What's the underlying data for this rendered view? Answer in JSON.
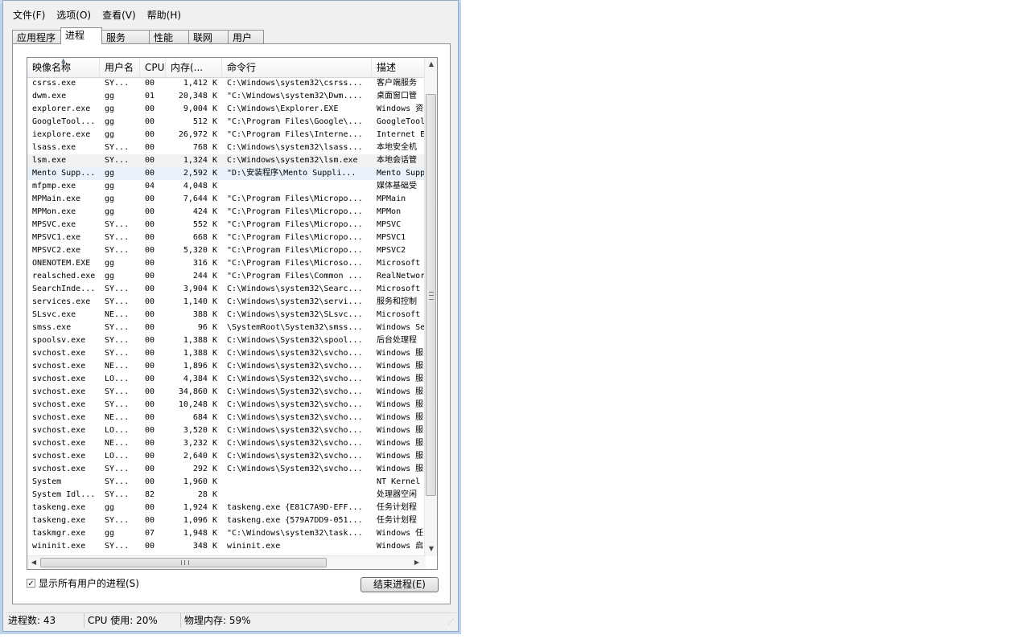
{
  "menu": [
    "文件(F)",
    "选项(O)",
    "查看(V)",
    "帮助(H)"
  ],
  "tabs": [
    "应用程序",
    "进程",
    "服务",
    "性能",
    "联网",
    "用户"
  ],
  "active_tab": "进程",
  "columns": [
    "映像名称",
    "用户名",
    "CPU",
    "内存(...",
    "命令行",
    "描述"
  ],
  "processes": [
    {
      "name": "csrss.exe",
      "user": "SY...",
      "cpu": "00",
      "mem": "1,412 K",
      "cmd": "C:\\Windows\\system32\\csrss...",
      "desc": "客户端服务"
    },
    {
      "name": "dwm.exe",
      "user": "gg",
      "cpu": "01",
      "mem": "20,348 K",
      "cmd": "\"C:\\Windows\\system32\\Dwm....",
      "desc": "桌面窗口管"
    },
    {
      "name": "explorer.exe",
      "user": "gg",
      "cpu": "00",
      "mem": "9,004 K",
      "cmd": "C:\\Windows\\Explorer.EXE",
      "desc": "Windows 资"
    },
    {
      "name": "GoogleTool...",
      "user": "gg",
      "cpu": "00",
      "mem": "512 K",
      "cmd": "\"C:\\Program Files\\Google\\...",
      "desc": "GoogleTool"
    },
    {
      "name": "iexplore.exe",
      "user": "gg",
      "cpu": "00",
      "mem": "26,972 K",
      "cmd": "\"C:\\Program Files\\Interne...",
      "desc": "Internet E"
    },
    {
      "name": "lsass.exe",
      "user": "SY...",
      "cpu": "00",
      "mem": "768 K",
      "cmd": "C:\\Windows\\system32\\lsass...",
      "desc": "本地安全机"
    },
    {
      "name": "lsm.exe",
      "user": "SY...",
      "cpu": "00",
      "mem": "1,324 K",
      "cmd": "C:\\Windows\\system32\\lsm.exe",
      "desc": "本地会话管"
    },
    {
      "name": "Mento Supp...",
      "user": "gg",
      "cpu": "00",
      "mem": "2,592 K",
      "cmd": "\"D:\\安装程序\\Mento Suppli...",
      "desc": "Mento Supp"
    },
    {
      "name": "mfpmp.exe",
      "user": "gg",
      "cpu": "04",
      "mem": "4,048 K",
      "cmd": "",
      "desc": "媒体基础受"
    },
    {
      "name": "MPMain.exe",
      "user": "gg",
      "cpu": "00",
      "mem": "7,644 K",
      "cmd": "\"C:\\Program Files\\Micropo...",
      "desc": "MPMain"
    },
    {
      "name": "MPMon.exe",
      "user": "gg",
      "cpu": "00",
      "mem": "424 K",
      "cmd": "\"C:\\Program Files\\Micropo...",
      "desc": "MPMon"
    },
    {
      "name": "MPSVC.exe",
      "user": "SY...",
      "cpu": "00",
      "mem": "552 K",
      "cmd": "\"C:\\Program Files\\Micropo...",
      "desc": "MPSVC"
    },
    {
      "name": "MPSVC1.exe",
      "user": "SY...",
      "cpu": "00",
      "mem": "668 K",
      "cmd": "\"C:\\Program Files\\Micropo...",
      "desc": "MPSVC1"
    },
    {
      "name": "MPSVC2.exe",
      "user": "SY...",
      "cpu": "00",
      "mem": "5,320 K",
      "cmd": "\"C:\\Program Files\\Micropo...",
      "desc": "MPSVC2"
    },
    {
      "name": "ONENOTEM.EXE",
      "user": "gg",
      "cpu": "00",
      "mem": "316 K",
      "cmd": "\"C:\\Program Files\\Microso...",
      "desc": "Microsoft"
    },
    {
      "name": "realsched.exe",
      "user": "gg",
      "cpu": "00",
      "mem": "244 K",
      "cmd": "\"C:\\Program Files\\Common ...",
      "desc": "RealNetwor"
    },
    {
      "name": "SearchInde...",
      "user": "SY...",
      "cpu": "00",
      "mem": "3,904 K",
      "cmd": "C:\\Windows\\system32\\Searc...",
      "desc": "Microsoft"
    },
    {
      "name": "services.exe",
      "user": "SY...",
      "cpu": "00",
      "mem": "1,140 K",
      "cmd": "C:\\Windows\\system32\\servi...",
      "desc": "服务和控制"
    },
    {
      "name": "SLsvc.exe",
      "user": "NE...",
      "cpu": "00",
      "mem": "388 K",
      "cmd": "C:\\Windows\\system32\\SLsvc...",
      "desc": "Microsoft"
    },
    {
      "name": "smss.exe",
      "user": "SY...",
      "cpu": "00",
      "mem": "96 K",
      "cmd": "\\SystemRoot\\System32\\smss...",
      "desc": "Windows Se"
    },
    {
      "name": "spoolsv.exe",
      "user": "SY...",
      "cpu": "00",
      "mem": "1,388 K",
      "cmd": "C:\\Windows\\System32\\spool...",
      "desc": "后台处理程"
    },
    {
      "name": "svchost.exe",
      "user": "SY...",
      "cpu": "00",
      "mem": "1,388 K",
      "cmd": "C:\\Windows\\system32\\svcho...",
      "desc": "Windows 服"
    },
    {
      "name": "svchost.exe",
      "user": "NE...",
      "cpu": "00",
      "mem": "1,896 K",
      "cmd": "C:\\Windows\\system32\\svcho...",
      "desc": "Windows 服"
    },
    {
      "name": "svchost.exe",
      "user": "LO...",
      "cpu": "00",
      "mem": "4,384 K",
      "cmd": "C:\\Windows\\System32\\svcho...",
      "desc": "Windows 服"
    },
    {
      "name": "svchost.exe",
      "user": "SY...",
      "cpu": "00",
      "mem": "34,860 K",
      "cmd": "C:\\Windows\\System32\\svcho...",
      "desc": "Windows 服"
    },
    {
      "name": "svchost.exe",
      "user": "SY...",
      "cpu": "00",
      "mem": "10,248 K",
      "cmd": "C:\\Windows\\system32\\svcho...",
      "desc": "Windows 服"
    },
    {
      "name": "svchost.exe",
      "user": "NE...",
      "cpu": "00",
      "mem": "684 K",
      "cmd": "C:\\Windows\\system32\\svcho...",
      "desc": "Windows 服"
    },
    {
      "name": "svchost.exe",
      "user": "LO...",
      "cpu": "00",
      "mem": "3,520 K",
      "cmd": "C:\\Windows\\system32\\svcho...",
      "desc": "Windows 服"
    },
    {
      "name": "svchost.exe",
      "user": "NE...",
      "cpu": "00",
      "mem": "3,232 K",
      "cmd": "C:\\Windows\\system32\\svcho...",
      "desc": "Windows 服"
    },
    {
      "name": "svchost.exe",
      "user": "LO...",
      "cpu": "00",
      "mem": "2,640 K",
      "cmd": "C:\\Windows\\system32\\svcho...",
      "desc": "Windows 服"
    },
    {
      "name": "svchost.exe",
      "user": "SY...",
      "cpu": "00",
      "mem": "292 K",
      "cmd": "C:\\Windows\\System32\\svcho...",
      "desc": "Windows 服"
    },
    {
      "name": "System",
      "user": "SY...",
      "cpu": "00",
      "mem": "1,960 K",
      "cmd": "",
      "desc": "NT Kernel"
    },
    {
      "name": "System Idl...",
      "user": "SY...",
      "cpu": "82",
      "mem": "28 K",
      "cmd": "",
      "desc": "处理器空闲"
    },
    {
      "name": "taskeng.exe",
      "user": "gg",
      "cpu": "00",
      "mem": "1,924 K",
      "cmd": "taskeng.exe {E81C7A9D-EFF...",
      "desc": "任务计划程"
    },
    {
      "name": "taskeng.exe",
      "user": "SY...",
      "cpu": "00",
      "mem": "1,096 K",
      "cmd": "taskeng.exe {579A7DD9-051...",
      "desc": "任务计划程"
    },
    {
      "name": "taskmgr.exe",
      "user": "gg",
      "cpu": "07",
      "mem": "1,948 K",
      "cmd": "\"C:\\Windows\\system32\\task...",
      "desc": "Windows 任"
    },
    {
      "name": "wininit.exe",
      "user": "SY...",
      "cpu": "00",
      "mem": "348 K",
      "cmd": "wininit.exe",
      "desc": "Windows 启"
    }
  ],
  "hover_row": 6,
  "selected_row": 7,
  "show_all_label": "显示所有用户的进程(S)",
  "show_all_checked": true,
  "end_process_label": "结束进程(E)",
  "status": {
    "processes": "进程数: 43",
    "cpu": "CPU 使用: 20%",
    "memory": "物理内存: 59%"
  },
  "icons": {
    "sort": "sort-up-icon",
    "check": "checkmark-icon"
  }
}
